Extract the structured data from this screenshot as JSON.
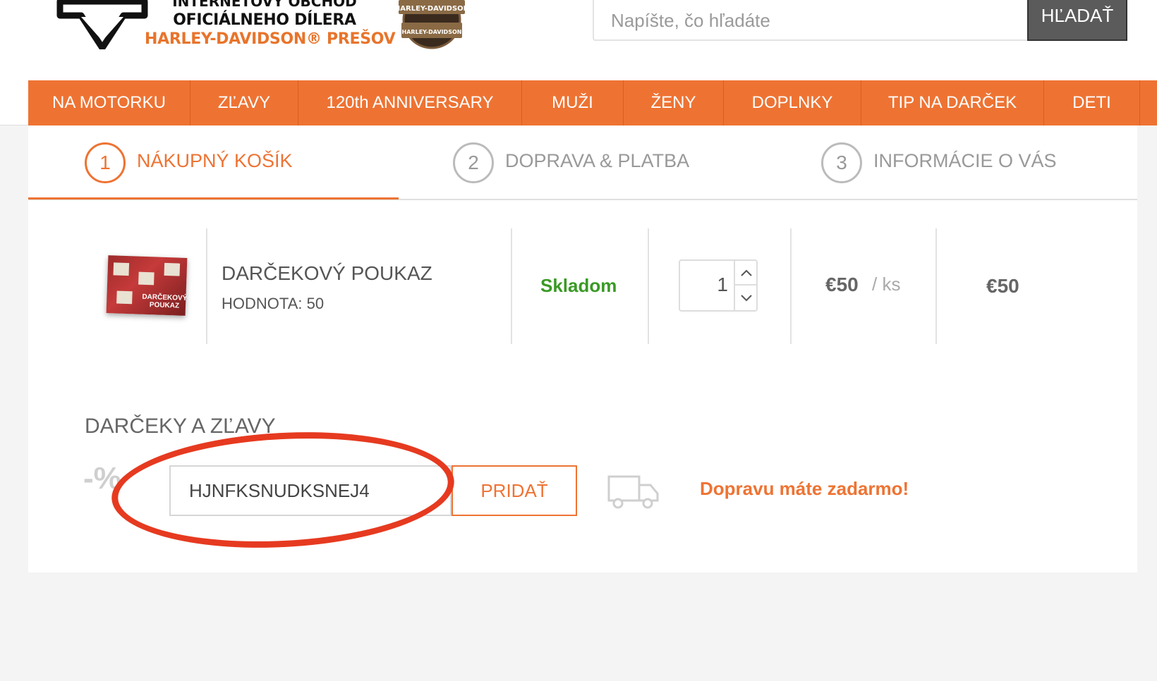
{
  "header": {
    "logo": {
      "line0": "INTERNETOVÝ OBCHOD",
      "line1": "OFICIÁLNEHO DÍLERA",
      "line2": "HARLEY-DAVIDSON® PREŠOV",
      "badge_text": "HARLEY-DAVIDSON"
    },
    "search": {
      "placeholder": "Napíšte, čo hľadáte",
      "button_label": "HĽADAŤ"
    }
  },
  "nav": {
    "items": [
      {
        "label": "NA MOTORKU"
      },
      {
        "label": "ZĽAVY"
      },
      {
        "label": "120th ANNIVERSARY"
      },
      {
        "label": "MUŽI"
      },
      {
        "label": "ŽENY"
      },
      {
        "label": "DOPLNKY"
      },
      {
        "label": "TIP NA DARČEK"
      },
      {
        "label": "DETI"
      }
    ]
  },
  "steps": [
    {
      "num": "1",
      "label": "NÁKUPNÝ KOŠÍK",
      "active": true
    },
    {
      "num": "2",
      "label": "DOPRAVA & PLATBA",
      "active": false
    },
    {
      "num": "3",
      "label": "INFORMÁCIE O VÁS",
      "active": false
    }
  ],
  "cart": {
    "item": {
      "name": "DARČEKOVÝ POUKAZ",
      "variant": "HODNOTA: 50",
      "thumb_text": "DARČEKOVÝ POUKAZ",
      "stock": "Skladom",
      "quantity": "1",
      "unit_price": "€50",
      "unit": "/ ks",
      "total": "€50"
    }
  },
  "discounts": {
    "title": "DARČEKY A ZĽAVY",
    "percent_icon": "-%",
    "code_value": "HJNFKSNUDKSNEJ4",
    "add_button": "PRIDAŤ",
    "free_shipping": "Dopravu máte zadarmo!"
  },
  "colors": {
    "accent": "#ee7333",
    "stock_green": "#3a9a25",
    "highlight_red": "#e63a20"
  }
}
